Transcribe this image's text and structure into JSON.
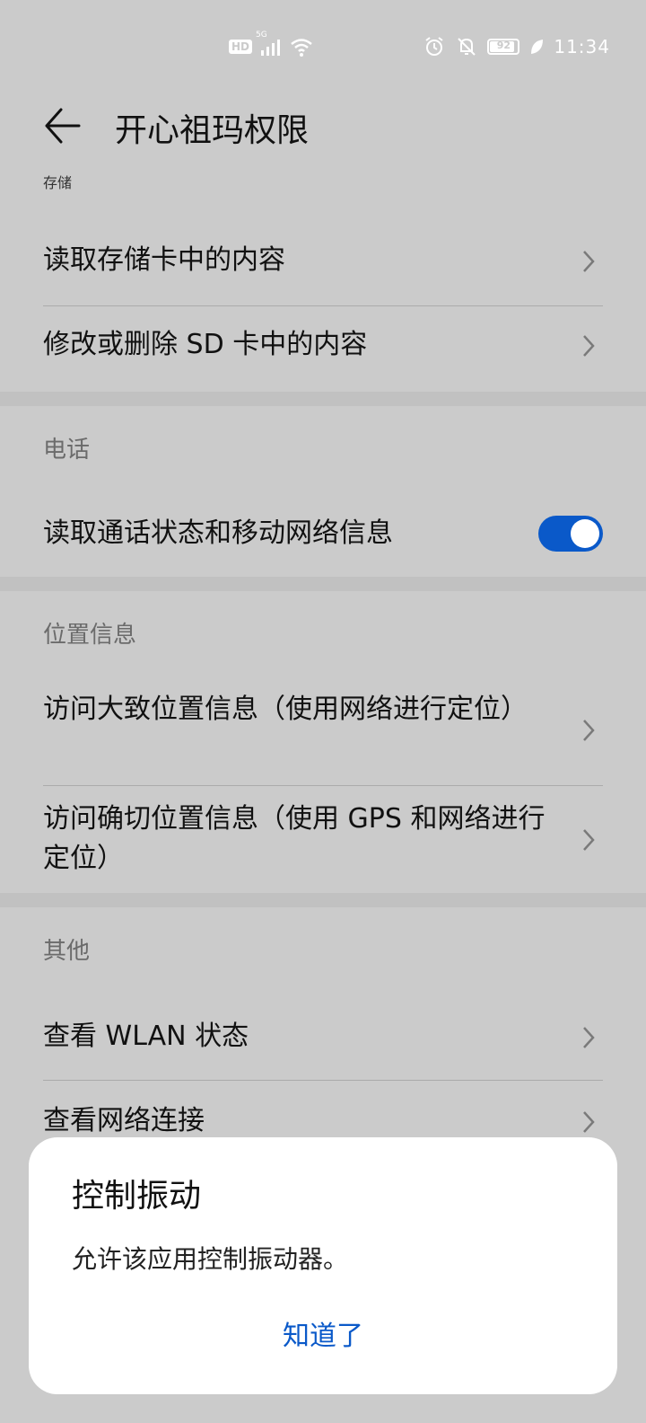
{
  "status_bar": {
    "hd_label": "HD",
    "network_label": "5G",
    "battery_level": "92",
    "battery_fraction": 0.92,
    "time": "11:34",
    "icons": [
      "hd-icon",
      "signal-icon",
      "wifi-icon",
      "alarm-icon",
      "mute-icon",
      "battery-icon",
      "leaf-icon"
    ]
  },
  "header": {
    "title": "开心祖玛权限",
    "cut_label": "存储"
  },
  "storage": {
    "items": [
      {
        "label": "读取存储卡中的内容"
      },
      {
        "label": "修改或删除 SD 卡中的内容"
      }
    ]
  },
  "phone": {
    "title": "电话",
    "items": [
      {
        "label": "读取通话状态和移动网络信息",
        "enabled": true
      }
    ]
  },
  "location": {
    "title": "位置信息",
    "items": [
      {
        "label": "访问大致位置信息（使用网络进行定位）"
      },
      {
        "label": "访问确切位置信息（使用 GPS 和网络进行定位）"
      }
    ]
  },
  "other": {
    "title": "其他",
    "items": [
      {
        "label": "查看 WLAN 状态"
      },
      {
        "label": "查看网络连接"
      }
    ]
  },
  "dialog": {
    "title": "控制振动",
    "body": "允许该应用控制振动器。",
    "button": "知道了"
  },
  "colors": {
    "background": "#cbcbcb",
    "accent": "#0a59c9",
    "dialog_bg": "#ffffff"
  }
}
